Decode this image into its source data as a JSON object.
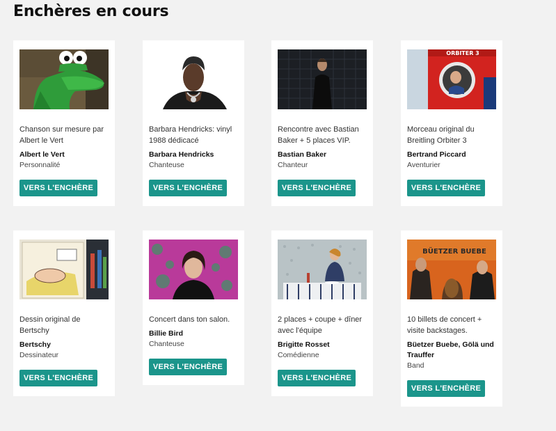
{
  "page": {
    "title": "Enchères en cours"
  },
  "auctions": [
    {
      "description": "Chanson sur mesure par Albert le Vert",
      "name": "Albert le Vert",
      "role": "Personnalité",
      "button_label": "VERS L'ENCHÈRE",
      "image": "green-frog-puppet"
    },
    {
      "description": "Barbara Hendricks: vinyl 1988 dédicacé",
      "name": "Barbara Hendricks",
      "role": "Chanteuse",
      "button_label": "VERS L'ENCHÈRE",
      "image": "singer-portrait"
    },
    {
      "description": "Rencontre avec Bastian Baker + 5 places VIP.",
      "name": "Bastian Baker",
      "role": "Chanteur",
      "button_label": "VERS L'ENCHÈRE",
      "image": "man-dark-tiles"
    },
    {
      "description": "Morceau original du Breitling Orbiter 3",
      "name": "Bertrand Piccard",
      "role": "Aventurier",
      "button_label": "VERS L'ENCHÈRE",
      "image": "orbiter-capsule",
      "image_text": "ORBITER 3"
    },
    {
      "description": "Dessin original de Bertschy",
      "name": "Bertschy",
      "role": "Dessinateur",
      "button_label": "VERS L'ENCHÈRE",
      "image": "drawing-sketchbook"
    },
    {
      "description": "Concert dans ton salon.",
      "name": "Billie Bird",
      "role": "Chanteuse",
      "button_label": "VERS L'ENCHÈRE",
      "image": "woman-pink-pattern"
    },
    {
      "description": "2 places + coupe + dîner avec l'équipe",
      "name": "Brigitte Rosset",
      "role": "Comédienne",
      "button_label": "VERS L'ENCHÈRE",
      "image": "woman-at-table"
    },
    {
      "description": "10 billets de concert + visite backstages.",
      "name": "Büetzer Buebe, Gölä und Trauffer",
      "role": "Band",
      "button_label": "VERS L'ENCHÈRE",
      "image": "band-poster",
      "image_text": "BÜETZER BUEBE"
    }
  ],
  "colors": {
    "accent": "#1b958b",
    "background": "#f2f2f2",
    "card": "#ffffff"
  }
}
